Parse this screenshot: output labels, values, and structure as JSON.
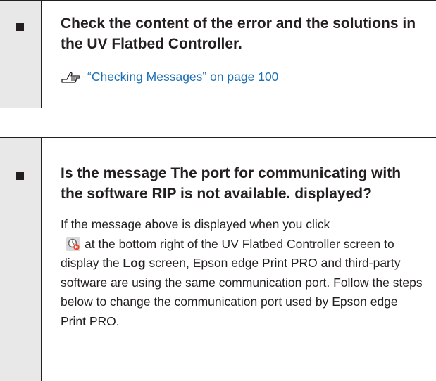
{
  "section1": {
    "question": "Check the content of the error and the solutions in the UV Flatbed Controller.",
    "link_icon": "pointing-hand-icon",
    "link_text": "“Checking Messages” on page 100"
  },
  "section2": {
    "question": "Is the message The port for communicating with the software RIP is not available. displayed?",
    "body_part1": "If the message above is displayed when you click",
    "log_icon": "log-error-icon",
    "body_part2": "at the bottom right of the UV Flatbed Controller screen to display the",
    "body_bold": "Log",
    "body_part3": "screen, Epson edge Print PRO and third-party software are using the same communication port. Follow the steps below to change the communication port used by Epson edge Print PRO."
  },
  "colors": {
    "bullet_column_bg": "#e8e8e8",
    "link": "#1a6fb5",
    "text": "#231f20"
  }
}
